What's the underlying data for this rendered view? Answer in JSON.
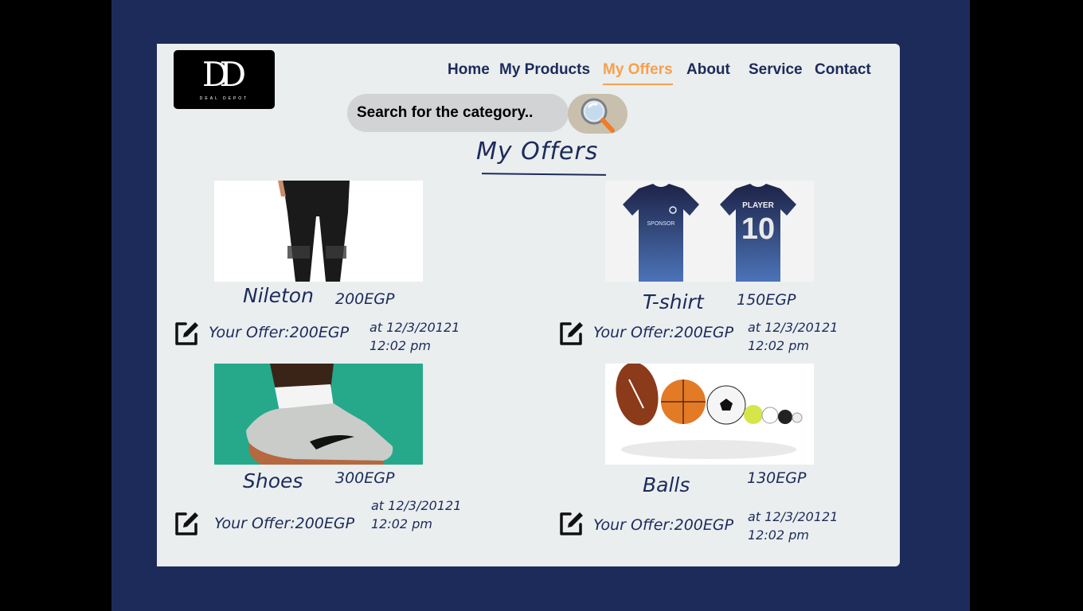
{
  "logo": {
    "mark": "DD",
    "sub": "DEAL DEPOT"
  },
  "nav": {
    "home": "Home",
    "products": "My Products",
    "offers": "My Offers",
    "about": "About",
    "service": "Service",
    "contact": "Contact"
  },
  "search": {
    "placeholder": "Search for the category..",
    "icon": "magnifier-icon"
  },
  "page_title": "My Offers",
  "offers": [
    {
      "name": "Nileton",
      "price": "200EGP",
      "offer": "Your Offer:200EGP",
      "date": "at 12/3/20121",
      "time": "12:02 pm",
      "image": "leggings-photo"
    },
    {
      "name": "T-shirt",
      "price": "150EGP",
      "offer": "Your Offer:200EGP",
      "date": "at 12/3/20121",
      "time": "12:02 pm",
      "image": "jersey-photo",
      "jersey_number": "10",
      "jersey_text": "PLAYER",
      "jersey_sponsor": "SPONSOR"
    },
    {
      "name": "Shoes",
      "price": "300EGP",
      "offer": "Your Offer:200EGP",
      "date": "at 12/3/20121",
      "time": "12:02 pm",
      "image": "sneaker-photo"
    },
    {
      "name": "Balls",
      "price": "130EGP",
      "offer": "Your Offer:200EGP",
      "date": "at 12/3/20121",
      "time": "12:02 pm",
      "image": "balls-photo"
    }
  ],
  "colors": {
    "navy": "#1d2b5a",
    "accent": "#f7a04a",
    "card": "#eaeeef"
  }
}
